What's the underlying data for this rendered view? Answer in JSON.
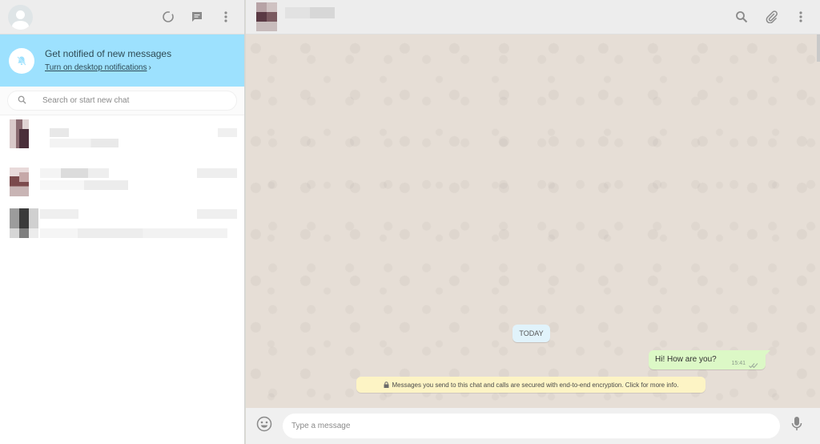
{
  "left_header": {
    "icons": [
      "default-avatar-icon",
      "status-icon",
      "new-chat-icon",
      "menu-dots-icon"
    ]
  },
  "notification_banner": {
    "icon": "bell-off-icon",
    "title": "Get notified of new messages",
    "link_label": "Turn on desktop notifications",
    "chevron": "›"
  },
  "search": {
    "placeholder": "Search or start new chat",
    "icon": "search-icon"
  },
  "chat_list": {
    "items": [
      {
        "name": "",
        "preview": "",
        "time": "",
        "blurred": true
      },
      {
        "name": "",
        "preview": "",
        "time": "",
        "blurred": true
      },
      {
        "name": "",
        "preview": "",
        "time": "",
        "blurred": true
      }
    ]
  },
  "conversation_header": {
    "contact_name": "",
    "blurred": true,
    "icons": [
      "search-icon",
      "attach-icon",
      "menu-dots-icon"
    ]
  },
  "conversation": {
    "date_label": "TODAY",
    "messages": [
      {
        "direction": "outgoing",
        "text": "Hi! How are you?",
        "time": "15:41",
        "status": "delivered-double-tick"
      }
    ],
    "encryption_notice": "Messages you send to this chat and calls are secured with end-to-end encryption. Click for more info."
  },
  "composer": {
    "placeholder": "Type a message",
    "left_icon": "emoji-icon",
    "right_icon": "microphone-icon"
  },
  "colors": {
    "banner_bg": "#9de1fe",
    "chat_bg": "#e6ded6",
    "outgoing_bubble": "#dcf8c6",
    "date_pill": "#e1f3fb",
    "encryption_note": "#fdf4c5"
  }
}
